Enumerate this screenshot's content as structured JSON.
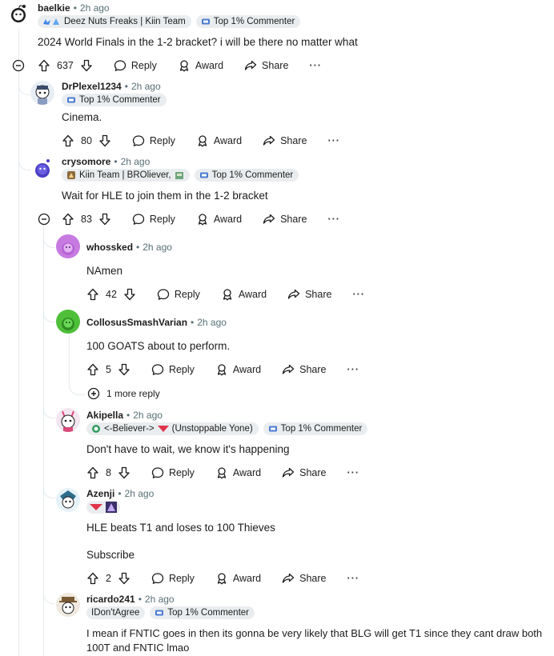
{
  "actions": {
    "reply": "Reply",
    "award": "Award",
    "share": "Share",
    "more": "···"
  },
  "comments": [
    {
      "username": "baelkie",
      "time": "2h ago",
      "flairs": [
        "Deez Nuts Freaks | Kiin Team",
        "Top 1% Commenter"
      ],
      "body": "2024 World Finals in the 1-2 bracket? i will be there no matter what",
      "votes": "637"
    },
    {
      "username": "DrPlexel1234",
      "time": "2h ago",
      "flairs": [
        "Top 1% Commenter"
      ],
      "body": "Cinema.",
      "votes": "80"
    },
    {
      "username": "crysomore",
      "time": "2h ago",
      "flairs": [
        "Kiin Team | BROliever,",
        "Top 1% Commenter"
      ],
      "body": "Wait for HLE to join them in the 1-2 bracket",
      "votes": "83"
    },
    {
      "username": "whossked",
      "time": "2h ago",
      "flairs": [],
      "body": "NAmen",
      "votes": "42"
    },
    {
      "username": "CollosusSmashVarian",
      "time": "2h ago",
      "flairs": [],
      "body": "100 GOATS about to perform.",
      "votes": "5"
    },
    {
      "username": "Akipella",
      "time": "2h ago",
      "flairs": [
        "<-Believer->",
        "(Unstoppable Yone)",
        "Top 1% Commenter"
      ],
      "body": "Don't have to wait, we know it's happening",
      "votes": "8"
    },
    {
      "username": "Azenji",
      "time": "2h ago",
      "flairs": [],
      "body": "HLE beats T1 and loses to 100 Thieves",
      "body2": "Subscribe",
      "votes": "2"
    },
    {
      "username": "ricardo241",
      "time": "2h ago",
      "flairs": [
        "IDon'tAgree",
        "Top 1% Commenter"
      ],
      "body": "I mean if FNTIC goes in then its gonna be very likely that BLG will get T1 since they cant draw both",
      "body2": "100T and FNTIC lmao"
    }
  ],
  "more_replies": "1 more reply",
  "colors": {
    "thread_line": "#e5ebee",
    "flair_bg": "#eaedef",
    "meta_gray": "#576f76",
    "text": "#1c1c1c",
    "green_avatar": "#4fbf3a",
    "purple_avatar": "#c77be0"
  },
  "icons": [
    "snoo-avatar",
    "upvote-icon",
    "downvote-icon",
    "reply-icon",
    "award-icon",
    "share-icon",
    "collapse-icon",
    "expand-icon",
    "top-commenter-icon"
  ]
}
